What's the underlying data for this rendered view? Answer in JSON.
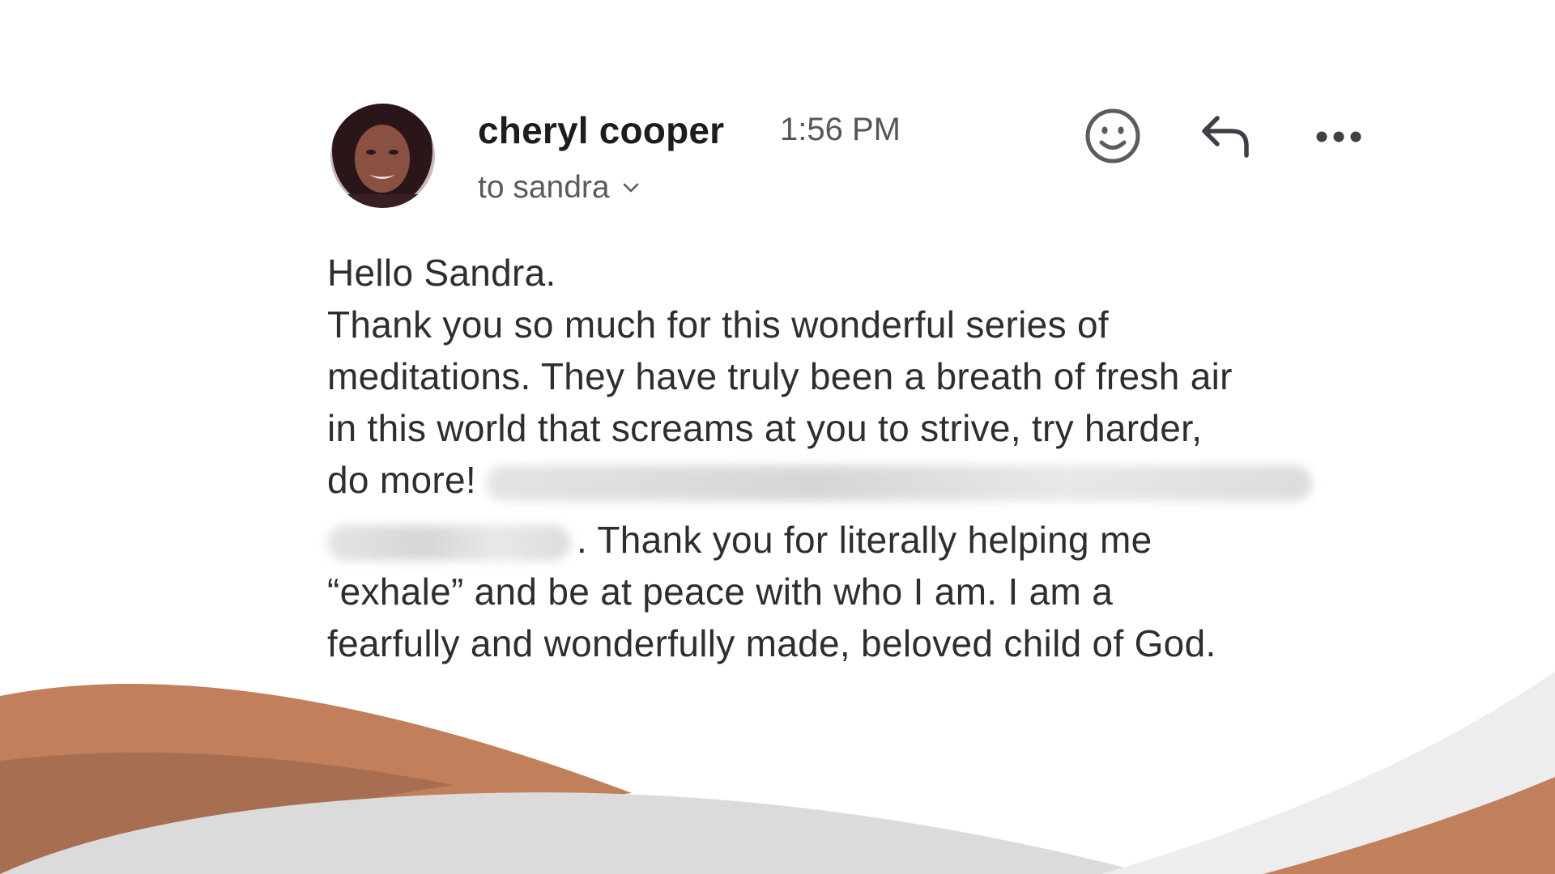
{
  "email": {
    "sender_name": "cheryl cooper",
    "time": "1:56 PM",
    "recipient": "to sandra",
    "actions": {
      "emoji_icon": "smiley-icon",
      "reply_icon": "reply-arrow-icon",
      "more_icon": "more-dots-icon"
    },
    "body": {
      "greeting": "Hello Sandra.",
      "line1": "Thank you so much for this wonderful series of",
      "line2": "meditations. They have truly been a breath of fresh air",
      "line3": "in this world that screams at you to strive, try harder,",
      "line4": "do more!",
      "line5": ". Thank you for literally helping me",
      "line6": "“exhale” and be at peace with who I am. I am a",
      "line7": "fearfully and wonderfully made, beloved child of God."
    }
  },
  "colors": {
    "wave_orange": "#c17f5b",
    "wave_dark": "#a86e51",
    "wave_gray": "#dcdbdb",
    "text": "#2e2e32"
  }
}
